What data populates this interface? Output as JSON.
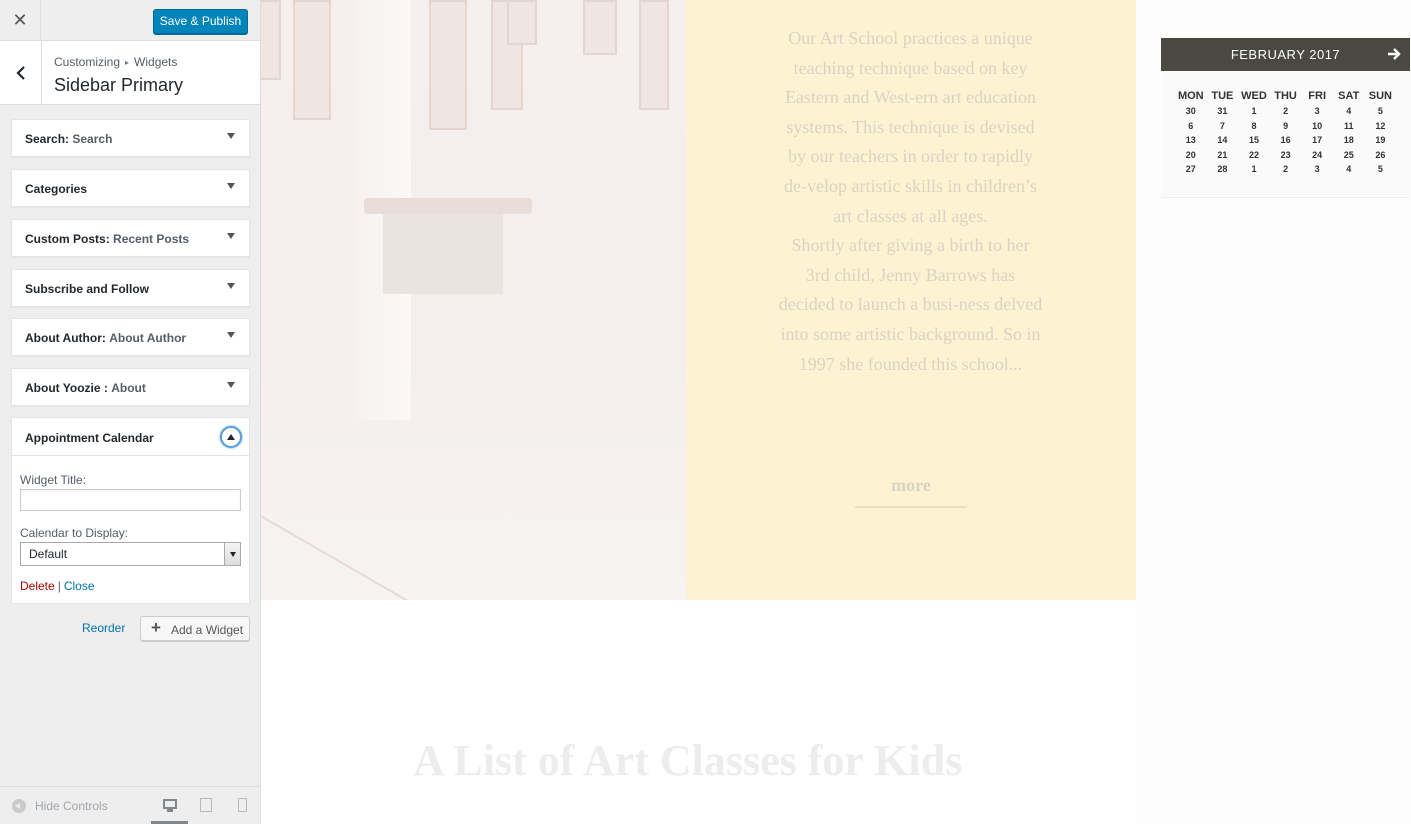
{
  "customizer": {
    "close_label": "✕",
    "save_label": "Save & Publish",
    "breadcrumb": {
      "first": "Customizing",
      "separator": "▸",
      "second": "Widgets"
    },
    "section_title": "Sidebar Primary",
    "widgets": [
      {
        "title": "Search",
        "instance": "Search"
      },
      {
        "title": "Categories",
        "instance": ""
      },
      {
        "title": "Custom Posts",
        "instance": "Recent Posts"
      },
      {
        "title": "Subscribe and Follow",
        "instance": ""
      },
      {
        "title": "About Author",
        "instance": "About Author"
      },
      {
        "title": "About Yoozie ",
        "instance": "About"
      }
    ],
    "expanded_widget": {
      "title": "Appointment Calendar",
      "widget_title_label": "Widget Title:",
      "widget_title_value": "",
      "calendar_label": "Calendar to Display:",
      "calendar_value": "Default",
      "delete_label": "Delete",
      "link_separator": "|",
      "close_label": "Close"
    },
    "reorder_label": "Reorder",
    "add_widget_label": "Add a Widget",
    "footer": {
      "hide_controls_label": "Hide Controls"
    },
    "active_device": "desktop"
  },
  "preview": {
    "about_text_1": "Our Art School practices a unique teaching technique based on key Eastern and West-ern art education systems. This technique is devised by our teachers in order to rapidly de-velop artistic skills in children’s art classes at all ages.",
    "about_text_2": "Shortly after giving a birth to her 3rd child, Jenny Barrows has decided to launch a busi-ness delved into some artistic background. So in 1997 she founded this school...",
    "more_label": "more",
    "list_heading": "A List of Art Classes for Kids",
    "calendar": {
      "month_label": "FEBRUARY 2017",
      "weekdays": [
        "MON",
        "TUE",
        "WED",
        "THU",
        "FRI",
        "SAT",
        "SUN"
      ],
      "weeks": [
        [
          "30",
          "31",
          "1",
          "2",
          "3",
          "4",
          "5"
        ],
        [
          "6",
          "7",
          "8",
          "9",
          "10",
          "11",
          "12"
        ],
        [
          "13",
          "14",
          "15",
          "16",
          "17",
          "18",
          "19"
        ],
        [
          "20",
          "21",
          "22",
          "23",
          "24",
          "25",
          "26"
        ],
        [
          "27",
          "28",
          "1",
          "2",
          "3",
          "4",
          "5"
        ]
      ]
    }
  },
  "colors": {
    "primary_button": "#0085ba",
    "link": "#0073aa",
    "delete_link": "#aa0000",
    "about_bg": "#fdf3d3",
    "calendar_header_bg": "#494841"
  },
  "icons": {
    "back": "chevron-left-icon",
    "expand": "triangle-down-icon",
    "collapse": "triangle-up-icon",
    "add": "plus-icon",
    "calendar_next": "arrow-right-icon",
    "hide_controls": "collapse-circle-icon",
    "devices": [
      "desktop-icon",
      "tablet-icon",
      "mobile-icon"
    ]
  }
}
